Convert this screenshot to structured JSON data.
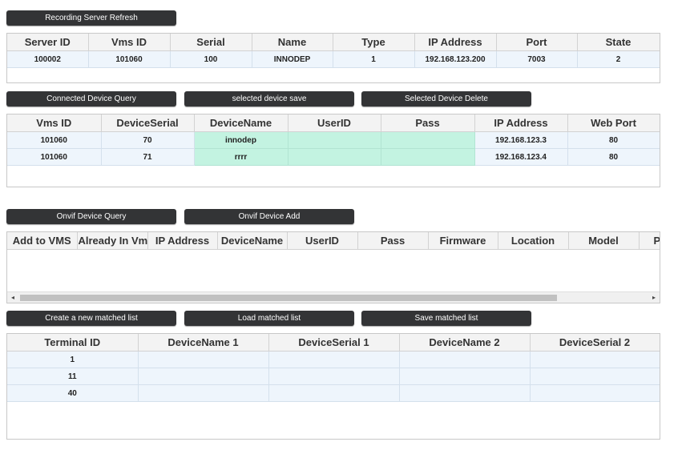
{
  "recording": {
    "refresh_label": "Recording Server Refresh",
    "columns": [
      "Server ID",
      "Vms ID",
      "Serial",
      "Name",
      "Type",
      "IP Address",
      "Port",
      "State"
    ],
    "rows": [
      [
        "100002",
        "101060",
        "100",
        "INNODEP",
        "1",
        "192.168.123.200",
        "7003",
        "2"
      ]
    ]
  },
  "connected": {
    "query_label": "Connected Device Query",
    "save_label": "selected device save",
    "delete_label": "Selected Device Delete",
    "columns": [
      "Vms ID",
      "DeviceSerial",
      "DeviceName",
      "UserID",
      "Pass",
      "IP Address",
      "Web Port"
    ],
    "rows": [
      [
        "101060",
        "70",
        "innodep",
        "",
        "",
        "192.168.123.3",
        "80"
      ],
      [
        "101060",
        "71",
        "rrrr",
        "",
        "",
        "192.168.123.4",
        "80"
      ]
    ]
  },
  "onvif": {
    "query_label": "Onvif Device Query",
    "add_label": "Onvif Device Add",
    "columns": [
      "Add to VMS",
      "Already In Vms",
      "IP Address",
      "DeviceName",
      "UserID",
      "Pass",
      "Firmware",
      "Location",
      "Model",
      "P"
    ],
    "rows": []
  },
  "matched": {
    "create_label": "Create a new matched list",
    "load_label": "Load matched list",
    "save_label": "Save matched list",
    "columns": [
      "Terminal ID",
      "DeviceName 1",
      "DeviceSerial 1",
      "DeviceName 2",
      "DeviceSerial 2"
    ],
    "rows": [
      [
        "1",
        "",
        "",
        "",
        ""
      ],
      [
        "11",
        "",
        "",
        "",
        ""
      ],
      [
        "40",
        "",
        "",
        "",
        ""
      ]
    ]
  },
  "icons": {
    "scroll_left": "◂",
    "scroll_right": "▸"
  },
  "colors": {
    "button_bg": "#333436",
    "row_bg": "#eef5fc",
    "editable_cell_bg": "#c3f3e1",
    "header_bg": "#f3f3f3"
  }
}
